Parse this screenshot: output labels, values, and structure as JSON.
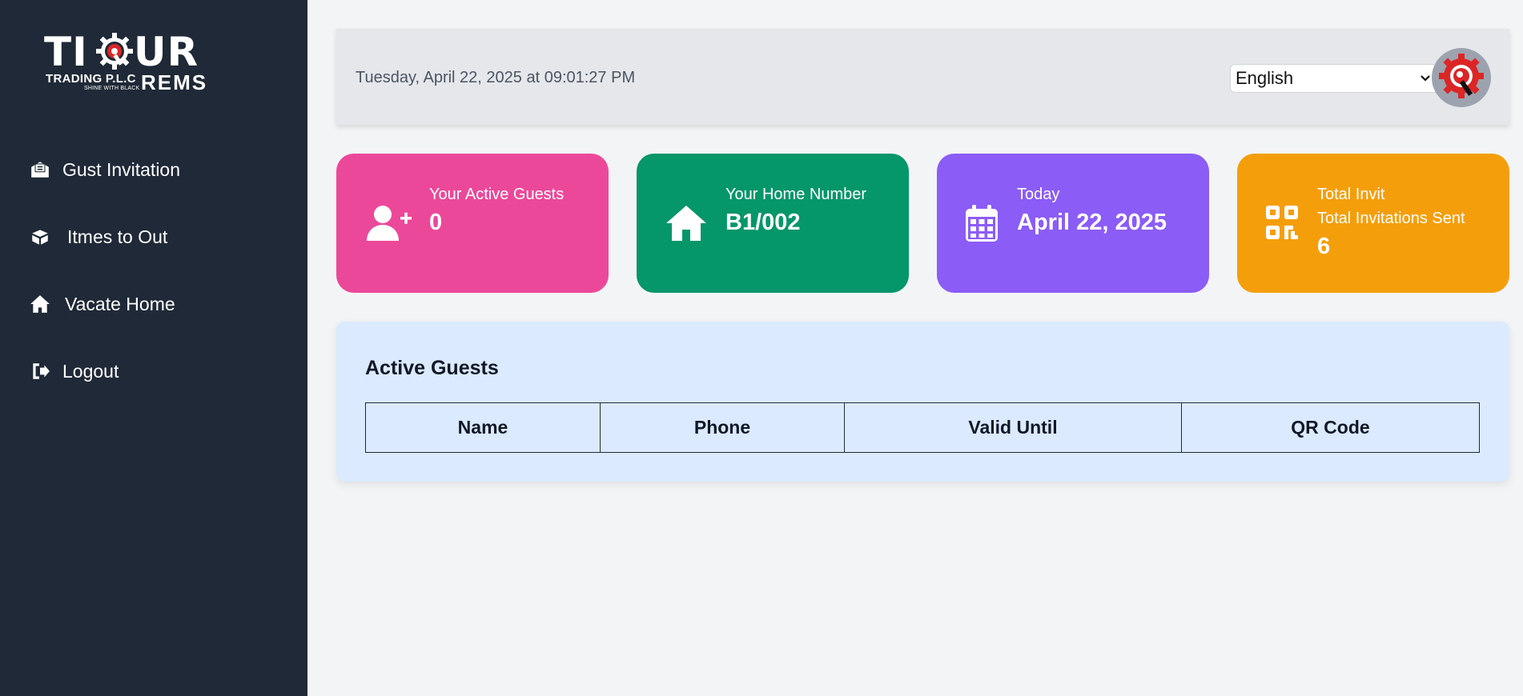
{
  "brand": {
    "logo_main_left": "TI",
    "logo_main_right": "UR",
    "logo_sub": "TRADING P.L.C",
    "logo_slogan": "SHINE WITH BLACK",
    "logo_product": "REMS"
  },
  "sidebar": {
    "items": [
      {
        "label": "Gust Invitation",
        "icon": "invitation-icon"
      },
      {
        "label": "Itmes to Out",
        "icon": "box-icon"
      },
      {
        "label": "Vacate Home",
        "icon": "home-icon"
      },
      {
        "label": "Logout",
        "icon": "logout-icon"
      }
    ]
  },
  "header": {
    "datetime": "Tuesday, April 22, 2025 at 09:01:27 PM",
    "language": "English"
  },
  "cards": [
    {
      "label": "Your Active Guests",
      "value": "0",
      "color": "#ec4899",
      "icon": "user-plus-icon"
    },
    {
      "label": "Your Home Number",
      "value": "B1/002",
      "color": "#059669",
      "icon": "house-icon"
    },
    {
      "label": "Today",
      "value": "April 22, 2025",
      "color": "#8b5cf6",
      "icon": "calendar-icon"
    },
    {
      "label": "Total Invit",
      "label2": "Total Invitations Sent",
      "value": "6",
      "color": "#f59e0b",
      "icon": "qr-code-icon"
    }
  ],
  "active_guests": {
    "title": "Active Guests",
    "columns": [
      "Name",
      "Phone",
      "Valid Until",
      "QR Code"
    ]
  }
}
